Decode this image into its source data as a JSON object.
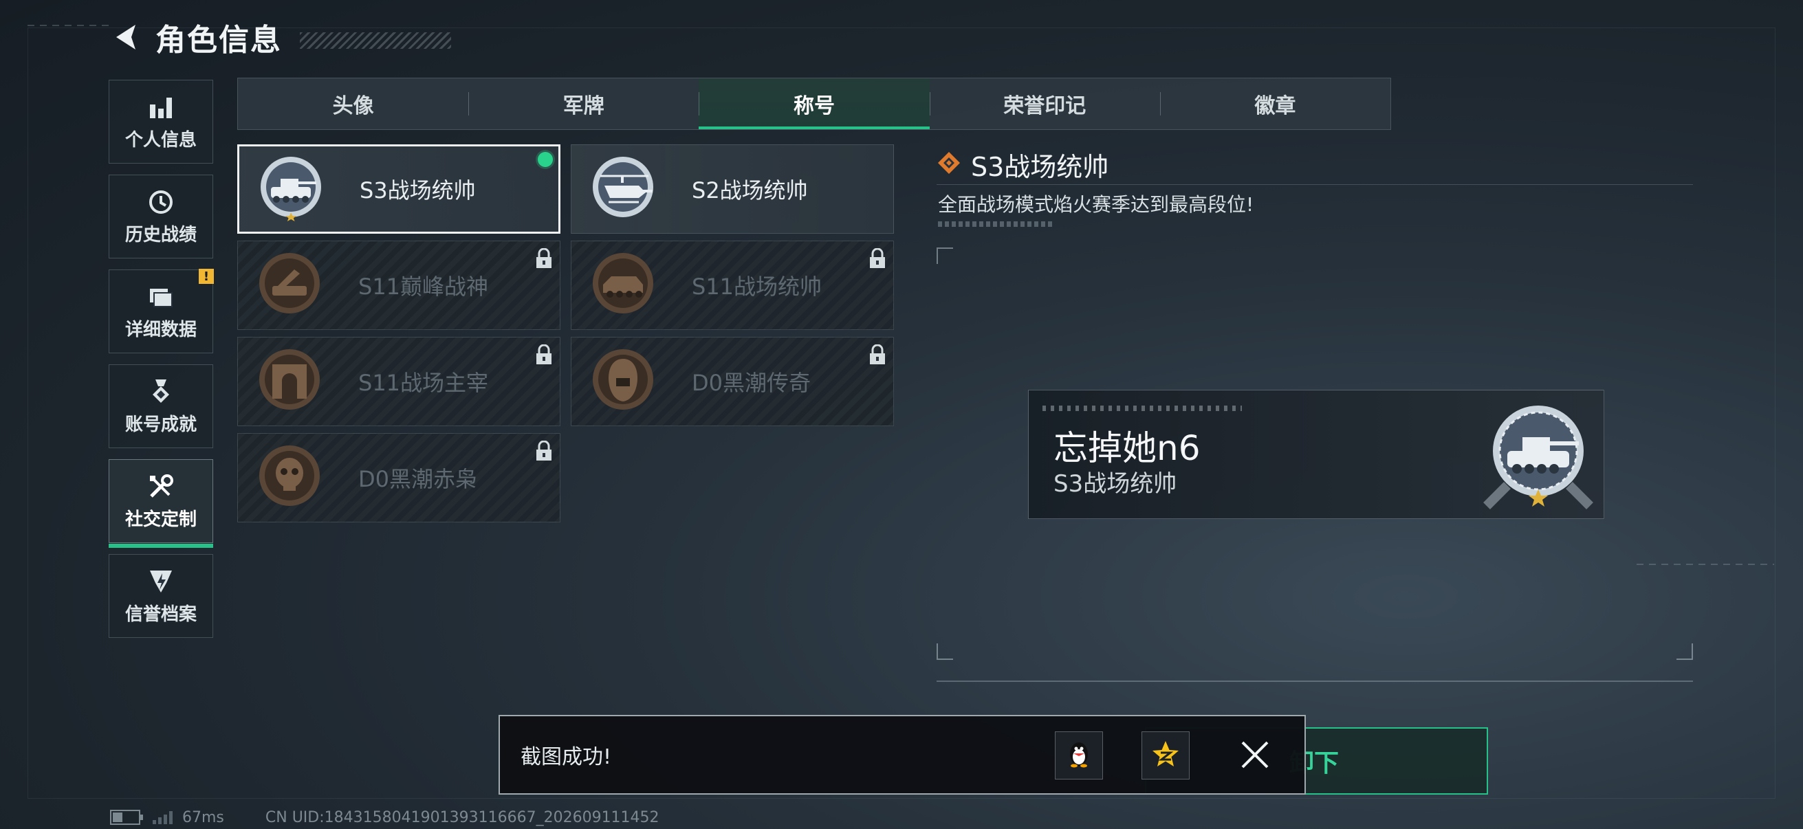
{
  "header": {
    "title": "角色信息",
    "back_icon": "back-arrow-icon"
  },
  "side_nav": {
    "items": [
      {
        "label": "个人信息",
        "icon": "bar-chart-icon",
        "active": false
      },
      {
        "label": "历史战绩",
        "icon": "history-clock-icon",
        "active": false
      },
      {
        "label": "详细数据",
        "icon": "folder-icon",
        "active": false,
        "badge": "!"
      },
      {
        "label": "账号成就",
        "icon": "medal-icon",
        "active": false
      },
      {
        "label": "社交定制",
        "icon": "wrench-tools-icon",
        "active": true
      },
      {
        "label": "信誉档案",
        "icon": "shield-badge-icon",
        "active": false
      }
    ]
  },
  "tabs": [
    {
      "label": "头像",
      "active": false
    },
    {
      "label": "军牌",
      "active": false
    },
    {
      "label": "称号",
      "active": true
    },
    {
      "label": "荣誉印记",
      "active": false
    },
    {
      "label": "徽章",
      "active": false
    }
  ],
  "titles": [
    {
      "name": "S3战场统帅",
      "emblem": "tank-emblem-icon",
      "locked": false,
      "selected": true,
      "equipped": true
    },
    {
      "name": "S2战场统帅",
      "emblem": "helicopter-emblem-icon",
      "locked": false,
      "selected": false,
      "equipped": false
    },
    {
      "name": "S11巅峰战神",
      "emblem": "launcher-emblem-icon",
      "locked": true,
      "selected": false,
      "equipped": false
    },
    {
      "name": "S11战场统帅",
      "emblem": "apc-emblem-icon",
      "locked": true,
      "selected": false,
      "equipped": false
    },
    {
      "name": "S11战场主宰",
      "emblem": "arch-emblem-icon",
      "locked": true,
      "selected": false,
      "equipped": false
    },
    {
      "name": "D0黑潮传奇",
      "emblem": "hooded-figure-emblem-icon",
      "locked": true,
      "selected": false,
      "equipped": false
    },
    {
      "name": "D0黑潮赤枭",
      "emblem": "skull-emblem-icon",
      "locked": true,
      "selected": false,
      "equipped": false
    }
  ],
  "detail": {
    "name": "S3战场统帅",
    "description": "全面战场模式焰火赛季达到最高段位!",
    "diamond_icon": "orange-diamond-icon"
  },
  "nameplate": {
    "player_name": "忘掉她n6",
    "title": "S3战场统帅"
  },
  "action": {
    "unequip_label": "卸下"
  },
  "toast": {
    "message": "截图成功!",
    "share_icons": [
      "qq-penguin-icon",
      "qzone-star-icon"
    ],
    "close_icon": "close-icon"
  },
  "footer": {
    "ping": "67ms",
    "uid": "CN UID:1843158041901393116667_202609111452"
  },
  "colors": {
    "accent_green": "#27c28a",
    "equipped_dot": "#2ad38c",
    "badge_yellow": "#f1b733",
    "diamond_orange": "#e07a2c"
  }
}
